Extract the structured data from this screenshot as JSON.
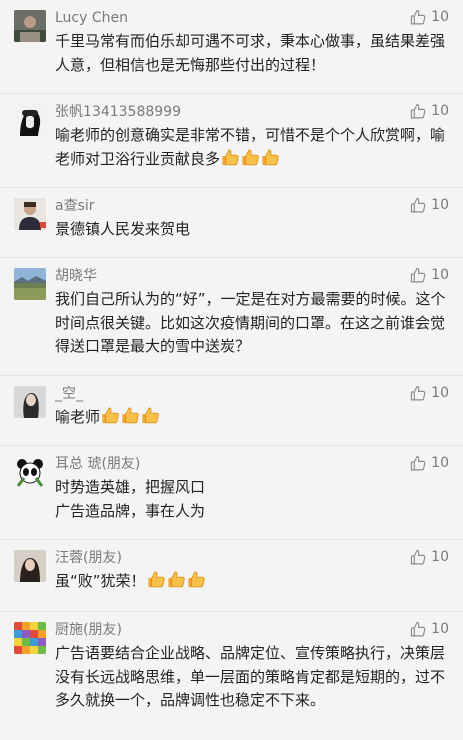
{
  "comments": [
    {
      "name": "Lucy Chen",
      "likes": "10",
      "text": "千里马常有而伯乐却可遇不可求，秉本心做事，虽结果差强人意，但相信也是无悔那些付出的过程！",
      "emojis": 0
    },
    {
      "name": "张帆13413588999",
      "likes": "10",
      "text": "喻老师的创意确实是非常不错，可惜不是个个人欣赏啊，喻老师对卫浴行业贡献良多",
      "emojis": 3
    },
    {
      "name": "a查sir",
      "likes": "10",
      "text": "景德镇人民发来贺电",
      "emojis": 0
    },
    {
      "name": "胡晓华",
      "likes": "10",
      "text": "我们自己所认为的“好”，一定是在对方最需要的时候。这个时间点很关键。比如这次疫情期间的口罩。在这之前谁会觉得送口罩是最大的雪中送炭？",
      "emojis": 0
    },
    {
      "name": "_空_",
      "likes": "10",
      "text": "喻老师",
      "emojis": 3
    },
    {
      "name": "耳总 琥(朋友)",
      "likes": "10",
      "text": "时势造英雄，把握风口\n广告造品牌，事在人为",
      "emojis": 0
    },
    {
      "name": "汪蓉(朋友)",
      "likes": "10",
      "text": "虽“败”犹荣！",
      "emojis": 3
    },
    {
      "name": "厨施(朋友)",
      "likes": "10",
      "text": "广告语要结合企业战略、品牌定位、宣传策略执行，决策层没有长远战略思维，单一层面的策略肯定都是短期的，过不多久就换一个，品牌调性也稳定不下来。",
      "emojis": 0
    }
  ],
  "colors": {
    "background": "#f4f4f4",
    "name": "#7a7a7a",
    "text": "#222222",
    "like_icon": "#8a8a8a",
    "emoji": "#f3b33d"
  },
  "icons": {
    "like": "thumbs-up-outline-icon",
    "emoji": "thumbs-up-emoji-icon"
  }
}
